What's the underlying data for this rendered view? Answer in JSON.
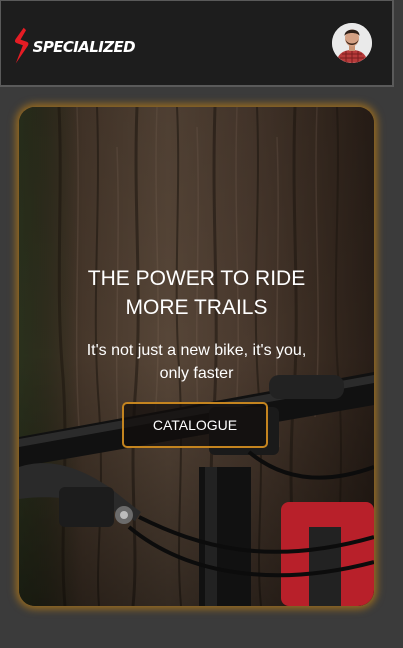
{
  "header": {
    "brand": "SPECIALIZED",
    "logo_icon": "specialized-s-logo-icon",
    "avatar_icon": "user-avatar-icon"
  },
  "hero": {
    "title": "THE POWER TO RIDE\nMORE TRAILS",
    "subtitle": "It's not just a new bike, it's you,\nonly faster",
    "cta_label": "CATALOGUE"
  },
  "colors": {
    "page_background": "#3b3b3b",
    "header_background": "#1d1d1d",
    "logo_red": "#e51c24",
    "accent_gold": "#c4841f"
  }
}
